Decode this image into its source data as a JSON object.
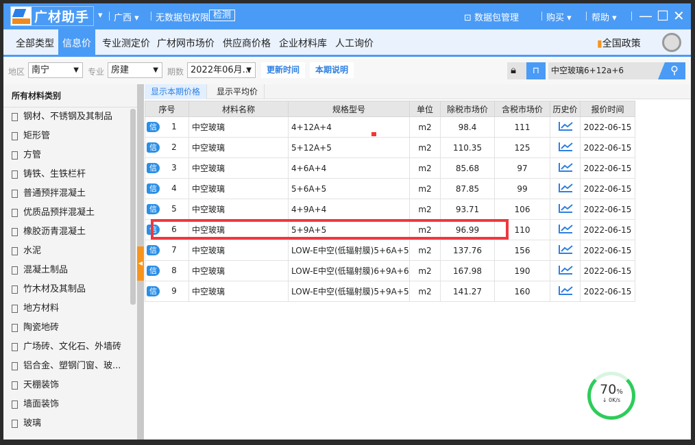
{
  "titlebar": {
    "app_name": "广材助手",
    "region": "广西",
    "permission": "无数据包权限",
    "check": "检测",
    "data_pkg": "数据包管理",
    "buy": "购买",
    "help": "帮助"
  },
  "nav": {
    "items": [
      "全部类型",
      "信息价",
      "专业测定价",
      "广材网市场价",
      "供应商价格",
      "企业材料库",
      "人工询价"
    ],
    "active": "信息价",
    "policy": "全国政策"
  },
  "filter": {
    "region_label": "地区",
    "region": "南宁",
    "major_label": "专业",
    "major": "房建",
    "period_label": "期数",
    "period": "2022年06月...",
    "update_btn": "更新时间",
    "desc_btn": "本期说明",
    "search_value": "中空玻璃6+12a+6"
  },
  "sidebar": {
    "title": "所有材料类别",
    "items": [
      "钢材、不锈钢及其制品",
      "矩形管",
      "方管",
      "铸铁、生铁栏杆",
      "普通预拌混凝土",
      "优质品预拌混凝土",
      "橡胶沥青混凝土",
      "水泥",
      "混凝土制品",
      "竹木材及其制品",
      "地方材料",
      "陶瓷地砖",
      "广场砖、文化石、外墙砖",
      "铝合金、塑钢门窗、玻...",
      "天棚装饰",
      "墙面装饰",
      "玻璃"
    ]
  },
  "tabs": {
    "current": "显示本期价格",
    "average": "显示平均价"
  },
  "table": {
    "headers": [
      "序号",
      "材料名称",
      "规格型号",
      "单位",
      "除税市场价",
      "含税市场价",
      "历史价",
      "报价时间"
    ],
    "badge": "信",
    "rows": [
      [
        "1",
        "中空玻璃",
        "4+12A+4",
        "m2",
        "98.4",
        "111",
        "2022-06-15"
      ],
      [
        "2",
        "中空玻璃",
        "5+12A+5",
        "m2",
        "110.35",
        "125",
        "2022-06-15"
      ],
      [
        "3",
        "中空玻璃",
        "4+6A+4",
        "m2",
        "85.68",
        "97",
        "2022-06-15"
      ],
      [
        "4",
        "中空玻璃",
        "5+6A+5",
        "m2",
        "87.85",
        "99",
        "2022-06-15"
      ],
      [
        "5",
        "中空玻璃",
        "4+9A+4",
        "m2",
        "93.71",
        "106",
        "2022-06-15"
      ],
      [
        "6",
        "中空玻璃",
        "5+9A+5",
        "m2",
        "96.99",
        "110",
        "2022-06-15"
      ],
      [
        "7",
        "中空玻璃",
        "LOW-E中空(低辐射膜)5+6A+5",
        "m2",
        "137.76",
        "156",
        "2022-06-15"
      ],
      [
        "8",
        "中空玻璃",
        "LOW-E中空(低辐射膜)6+9A+6",
        "m2",
        "167.98",
        "190",
        "2022-06-15"
      ],
      [
        "9",
        "中空玻璃",
        "LOW-E中空(低辐射膜)5+9A+5",
        "m2",
        "141.27",
        "160",
        "2022-06-15"
      ]
    ]
  },
  "gauge": {
    "percent": "70",
    "unit": "%",
    "speed": "0K/s",
    "progress": 0.7
  },
  "colors": {
    "brand": "#4a9bf5",
    "highlight": "#f0373c",
    "accent": "#f7941d"
  }
}
